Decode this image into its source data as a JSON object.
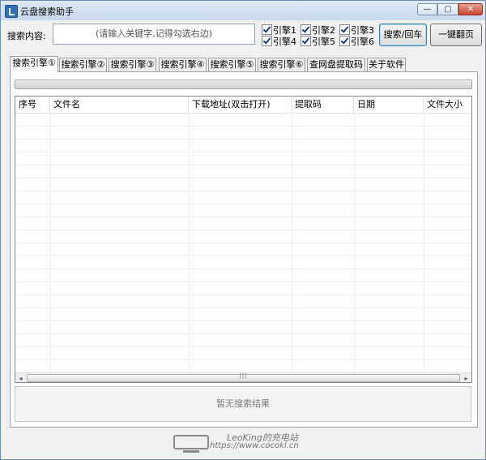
{
  "window": {
    "title": "云盘搜索助手",
    "min_glyph": "—",
    "max_glyph": "▢",
    "close_glyph": "✕"
  },
  "search": {
    "label": "搜索内容:",
    "placeholder": "(请输入关键字,记得勾选右边)"
  },
  "engines": [
    {
      "label": "引擎1",
      "checked": true
    },
    {
      "label": "引擎2",
      "checked": true
    },
    {
      "label": "引擎3",
      "checked": true
    },
    {
      "label": "引擎4",
      "checked": true
    },
    {
      "label": "引擎5",
      "checked": true
    },
    {
      "label": "引擎6",
      "checked": true
    }
  ],
  "buttons": {
    "search": "搜索/回车",
    "flip": "一键翻页"
  },
  "tabs": [
    "搜索引擎①",
    "搜索引擎②",
    "搜索引擎③",
    "搜索引擎④",
    "搜索引擎⑤",
    "搜索引擎⑥",
    "查网盘提取码",
    "关于软件"
  ],
  "columns": [
    "序号",
    "文件名",
    "下载地址(双击打开)",
    "提取码",
    "日期",
    "文件大小"
  ],
  "status": "暂无搜索结果",
  "scroll": {
    "left": "◂",
    "right": "▸",
    "grip": "|||"
  },
  "watermark": {
    "line1": "LeoKing的充电站",
    "line2": "https://www.cocokl.cn"
  }
}
